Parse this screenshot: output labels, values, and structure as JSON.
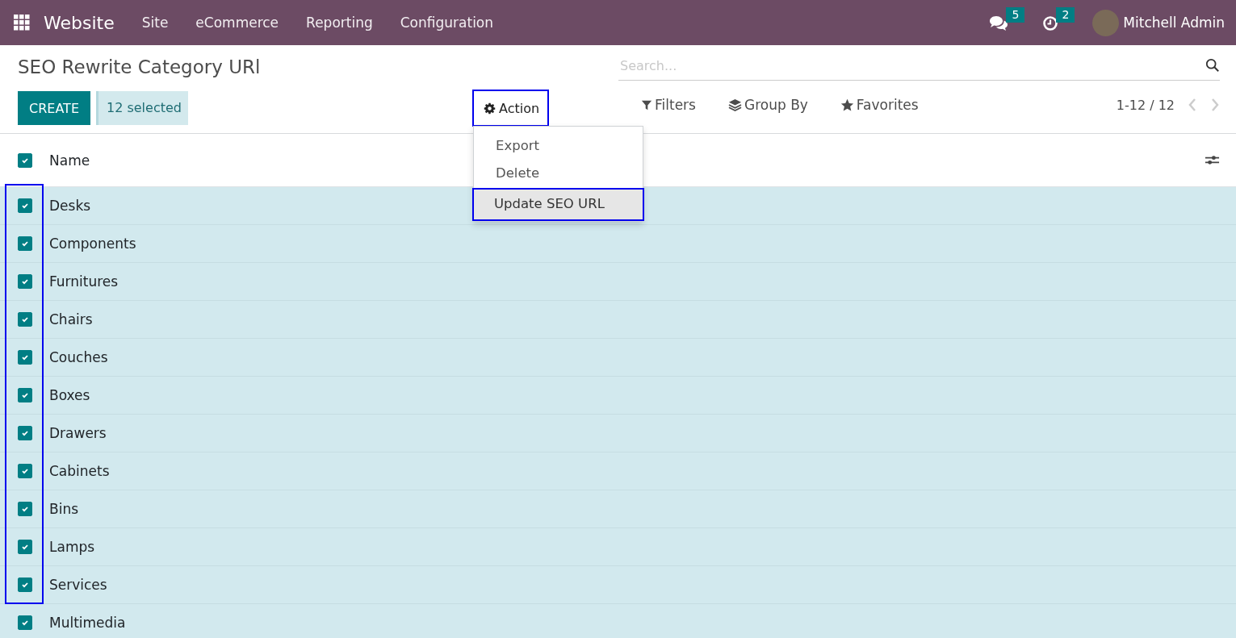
{
  "navbar": {
    "app_name": "Website",
    "menus": [
      "Site",
      "eCommerce",
      "Reporting",
      "Configuration"
    ],
    "messages_count": "5",
    "activities_count": "2",
    "user": "Mitchell Admin"
  },
  "control_panel": {
    "title": "SEO Rewrite Category URl",
    "create_label": "CREATE",
    "selected_label": "12 selected",
    "action": {
      "label": "Action",
      "expanded": true,
      "highlighted": true
    },
    "action_menu": [
      {
        "label": "Export",
        "selected": false,
        "highlighted": false
      },
      {
        "label": "Delete",
        "selected": false,
        "highlighted": false
      },
      {
        "label": "Update SEO URL",
        "selected": true,
        "highlighted": true
      }
    ],
    "search": {
      "placeholder": "Search..."
    },
    "filters": "Filters",
    "group_by": "Group By",
    "favorites": "Favorites",
    "pager": "1-12 / 12"
  },
  "table": {
    "header": {
      "label": "Name",
      "checked": true
    },
    "rows": [
      {
        "name": "Desks",
        "checked": true,
        "highlighted": true
      },
      {
        "name": "Components",
        "checked": true,
        "highlighted": true
      },
      {
        "name": "Furnitures",
        "checked": true,
        "highlighted": true
      },
      {
        "name": "Chairs",
        "checked": true,
        "highlighted": true
      },
      {
        "name": "Couches",
        "checked": true,
        "highlighted": true
      },
      {
        "name": "Boxes",
        "checked": true,
        "highlighted": true
      },
      {
        "name": "Drawers",
        "checked": true,
        "highlighted": true
      },
      {
        "name": "Cabinets",
        "checked": true,
        "highlighted": true
      },
      {
        "name": "Bins",
        "checked": true,
        "highlighted": true
      },
      {
        "name": "Lamps",
        "checked": true,
        "highlighted": true
      },
      {
        "name": "Services",
        "checked": true,
        "highlighted": true
      },
      {
        "name": "Multimedia",
        "checked": true,
        "highlighted": false
      }
    ]
  }
}
